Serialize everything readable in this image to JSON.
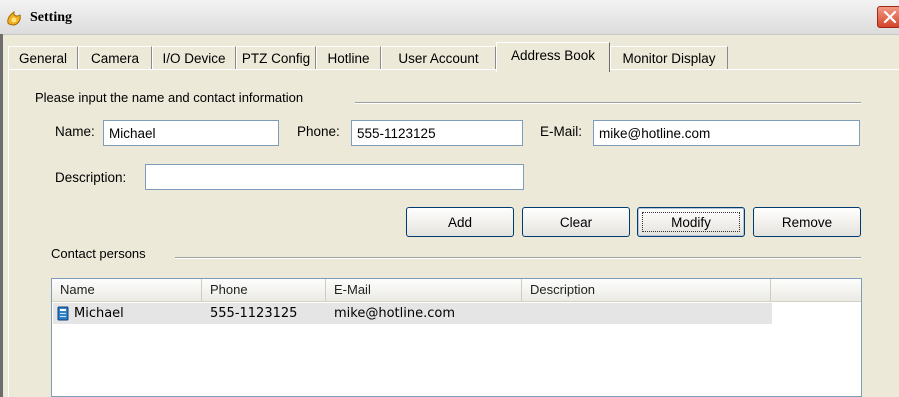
{
  "window": {
    "title": "Setting"
  },
  "tabs": [
    {
      "label": "General"
    },
    {
      "label": "Camera"
    },
    {
      "label": "I/O Device"
    },
    {
      "label": "PTZ Config"
    },
    {
      "label": "Hotline"
    },
    {
      "label": "User Account"
    },
    {
      "label": "Address Book",
      "active": true
    },
    {
      "label": "Monitor Display"
    }
  ],
  "contact_form": {
    "group_title": "Please input the name and contact information",
    "name_label": "Name:",
    "name_value": "Michael",
    "phone_label": "Phone:",
    "phone_value": "555-1123125",
    "email_label": "E-Mail:",
    "email_value": "mike@hotline.com",
    "description_label": "Description:",
    "description_value": ""
  },
  "buttons": {
    "add": "Add",
    "clear": "Clear",
    "modify": "Modify",
    "remove": "Remove"
  },
  "contacts": {
    "group_title": "Contact persons",
    "columns": [
      "Name",
      "Phone",
      "E-Mail",
      "Description"
    ],
    "rows": [
      {
        "name": "Michael",
        "phone": "555-1123125",
        "email": "mike@hotline.com",
        "description": "",
        "icon": "contact-card-icon",
        "selected": true
      }
    ]
  },
  "colors": {
    "window_bg": "#ece9d8",
    "close_button": "#d5442a",
    "selected_row": "#e5e5e5"
  }
}
